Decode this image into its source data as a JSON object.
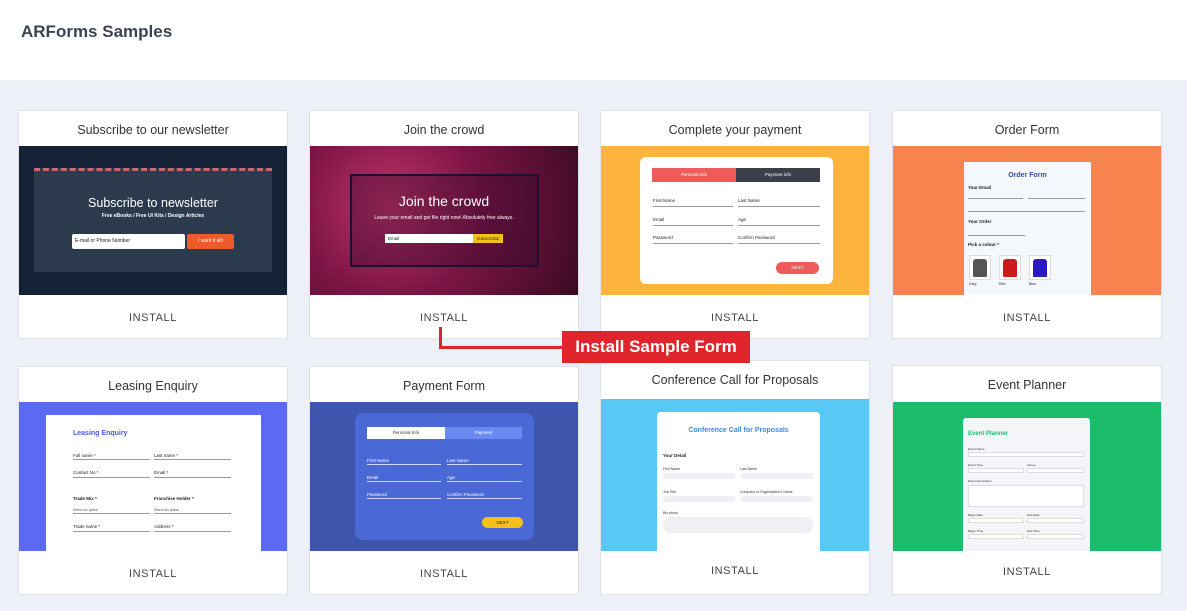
{
  "page": {
    "title": "ARForms Samples"
  },
  "install_label": "INSTALL",
  "callout": {
    "label": "Install Sample Form"
  },
  "cards": [
    {
      "title": "Subscribe to our newsletter",
      "preview": {
        "heading": "Subscribe to newsletter",
        "sub": "Free eBooks / Free UI Kits / Design Articles",
        "input_placeholder": "E-mail or Phone Number",
        "button": "I want it all!"
      }
    },
    {
      "title": "Join the crowd",
      "preview": {
        "heading": "Join the crowd",
        "sub": "Leave your email and get file right now! Absolutely free always.",
        "input_placeholder": "Email",
        "button": "SUBSCRIBE"
      }
    },
    {
      "title": "Complete your payment",
      "preview": {
        "tab1": "Personal info",
        "tab2": "Payment info",
        "fields": [
          "First Name",
          "Last Name",
          "Email",
          "Age",
          "Password",
          "Confirm Password"
        ],
        "button": "NEXT"
      }
    },
    {
      "title": "Order Form",
      "preview": {
        "heading": "Order Form",
        "section1": "Your Email",
        "section2": "Your Order",
        "section3": "Pick a colour *",
        "colors": [
          "Grey",
          "Red",
          "Blue"
        ]
      }
    },
    {
      "title": "Leasing Enquiry",
      "preview": {
        "heading": "Leasing Enquiry",
        "fields": [
          "Full name *",
          "Last name *",
          "Contact No *",
          "Email *"
        ],
        "selects": [
          "Trade Mix *",
          "Franchise Holder *"
        ],
        "select_placeholder": "Select an option",
        "fields2": [
          "Trade name *",
          "Address *"
        ]
      }
    },
    {
      "title": "Payment Form",
      "preview": {
        "tab1": "Personal Info",
        "tab2": "Payment",
        "fields": [
          "First Name",
          "Last Name",
          "Email",
          "Age",
          "Password",
          "Confirm Password"
        ],
        "button": "NEXT"
      }
    },
    {
      "title": "Conference Call for Proposals",
      "preview": {
        "heading": "Conference Call for Proposals",
        "section": "Your Detail",
        "fields": [
          "First Name",
          "Last Name",
          "Job Title",
          "Company or Organization's Name",
          "Bio photo"
        ]
      }
    },
    {
      "title": "Event Planner",
      "preview": {
        "heading": "Event Planner",
        "fields": [
          "Event Name",
          "Event Type",
          "Venue",
          "Event Description",
          "Begin Date",
          "End Date",
          "Begin Time",
          "End Time"
        ]
      }
    }
  ],
  "colors": {
    "accent_red": "#e0242c",
    "newsletter_bg": "#152236",
    "crowd_bg": "#8a1a4c",
    "payment_bg": "#fdb43c",
    "order_bg": "#f7834f",
    "leasing_bg": "#5a6af2",
    "payment_form_bg": "#3e56ad",
    "conference_bg": "#58c8f5",
    "event_bg": "#1bbd6c"
  }
}
